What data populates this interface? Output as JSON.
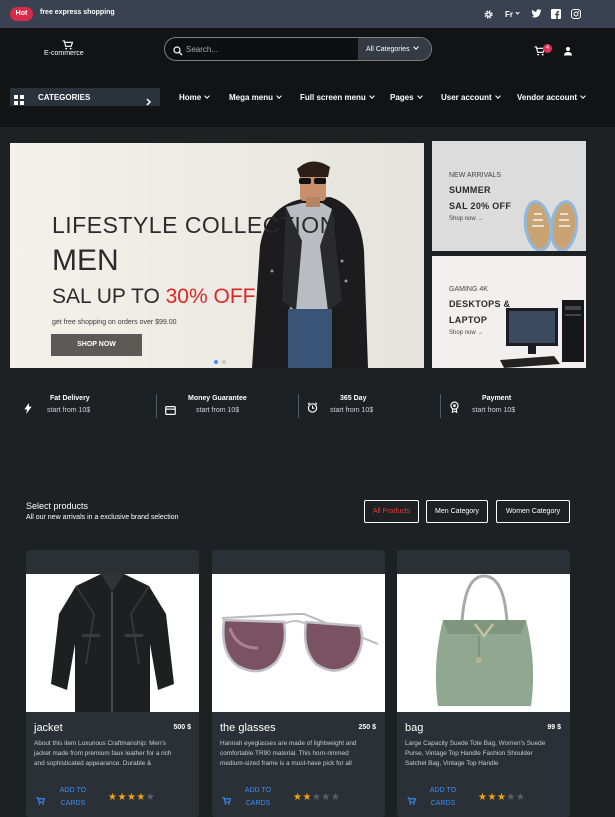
{
  "topbar": {
    "badge": "Hot",
    "promo": "free express shopping",
    "language": "Fr"
  },
  "header": {
    "logo": "E-commerce",
    "search_placeholder": "Search...",
    "category_select": "All Categories",
    "cart_count": "4"
  },
  "nav": {
    "categories_label": "CATEGORIES",
    "items": [
      "Home",
      "Mega menu",
      "Full screen menu",
      "Pages",
      "User account",
      "Vendor account"
    ]
  },
  "hero": {
    "line1": "LIFESTYLE COLLECTION",
    "line2": "MEN",
    "line3_prefix": "SAL UP TO ",
    "line3_highlight": "30% OFF",
    "subtitle": "get free shopping on orders over $99.00",
    "button": "SHOP NOW"
  },
  "side_banners": [
    {
      "eyebrow": "NEW ARRIVALS",
      "title1": "SUMMER",
      "title2": "SAL 20% OFF",
      "link": "Shop now"
    },
    {
      "eyebrow": "GAMING 4K",
      "title1": "DESKTOPS &",
      "title2": "LAPTOP",
      "link": "Shop now"
    }
  ],
  "features": [
    {
      "title": "Fat Delivery",
      "sub": "start from 10$",
      "icon": "bolt-icon"
    },
    {
      "title": "Money Guarantee",
      "sub": "start from 10$",
      "icon": "wallet-icon"
    },
    {
      "title": "365 Day",
      "sub": "start from 10$",
      "icon": "alarm-icon"
    },
    {
      "title": "Payment",
      "sub": "start from 10$",
      "icon": "medal-icon"
    }
  ],
  "products_section": {
    "title": "Select products",
    "subtitle": "All our new arrivals in a exclusive brand selection",
    "filters": [
      "All Products",
      "Men Category",
      "Women Category"
    ],
    "active_filter": 0
  },
  "products": [
    {
      "name": "jacket",
      "price": "500 $",
      "description": "About this item Luxurious Craftmanship: Men's jacket made from premium faux leather for a rich and sophisticated appearance. Durable &",
      "add_label": "ADD TO CARDS",
      "rating": 4
    },
    {
      "name": "the glasses",
      "price": "250 $",
      "description": "Hannah eyeglasses are made of lightweight and comfortable TR90 material. This horn-rimmed medium-sized frame is a must-have pick for all",
      "add_label": "ADD TO CARDS",
      "rating": 2
    },
    {
      "name": "bag",
      "price": "99 $",
      "description": "Large Capacity Suede Tote Bag, Women's Suede Purse, Vintage Top Handle Fashion Shoulder Satchel Bag, Vintage Top Handle",
      "add_label": "ADD TO CARDS",
      "rating": 3
    }
  ],
  "colors": {
    "accent_red": "#e02525",
    "badge_pink": "#e0335a",
    "link_blue": "#3f8ef5",
    "star": "#f1a413"
  }
}
